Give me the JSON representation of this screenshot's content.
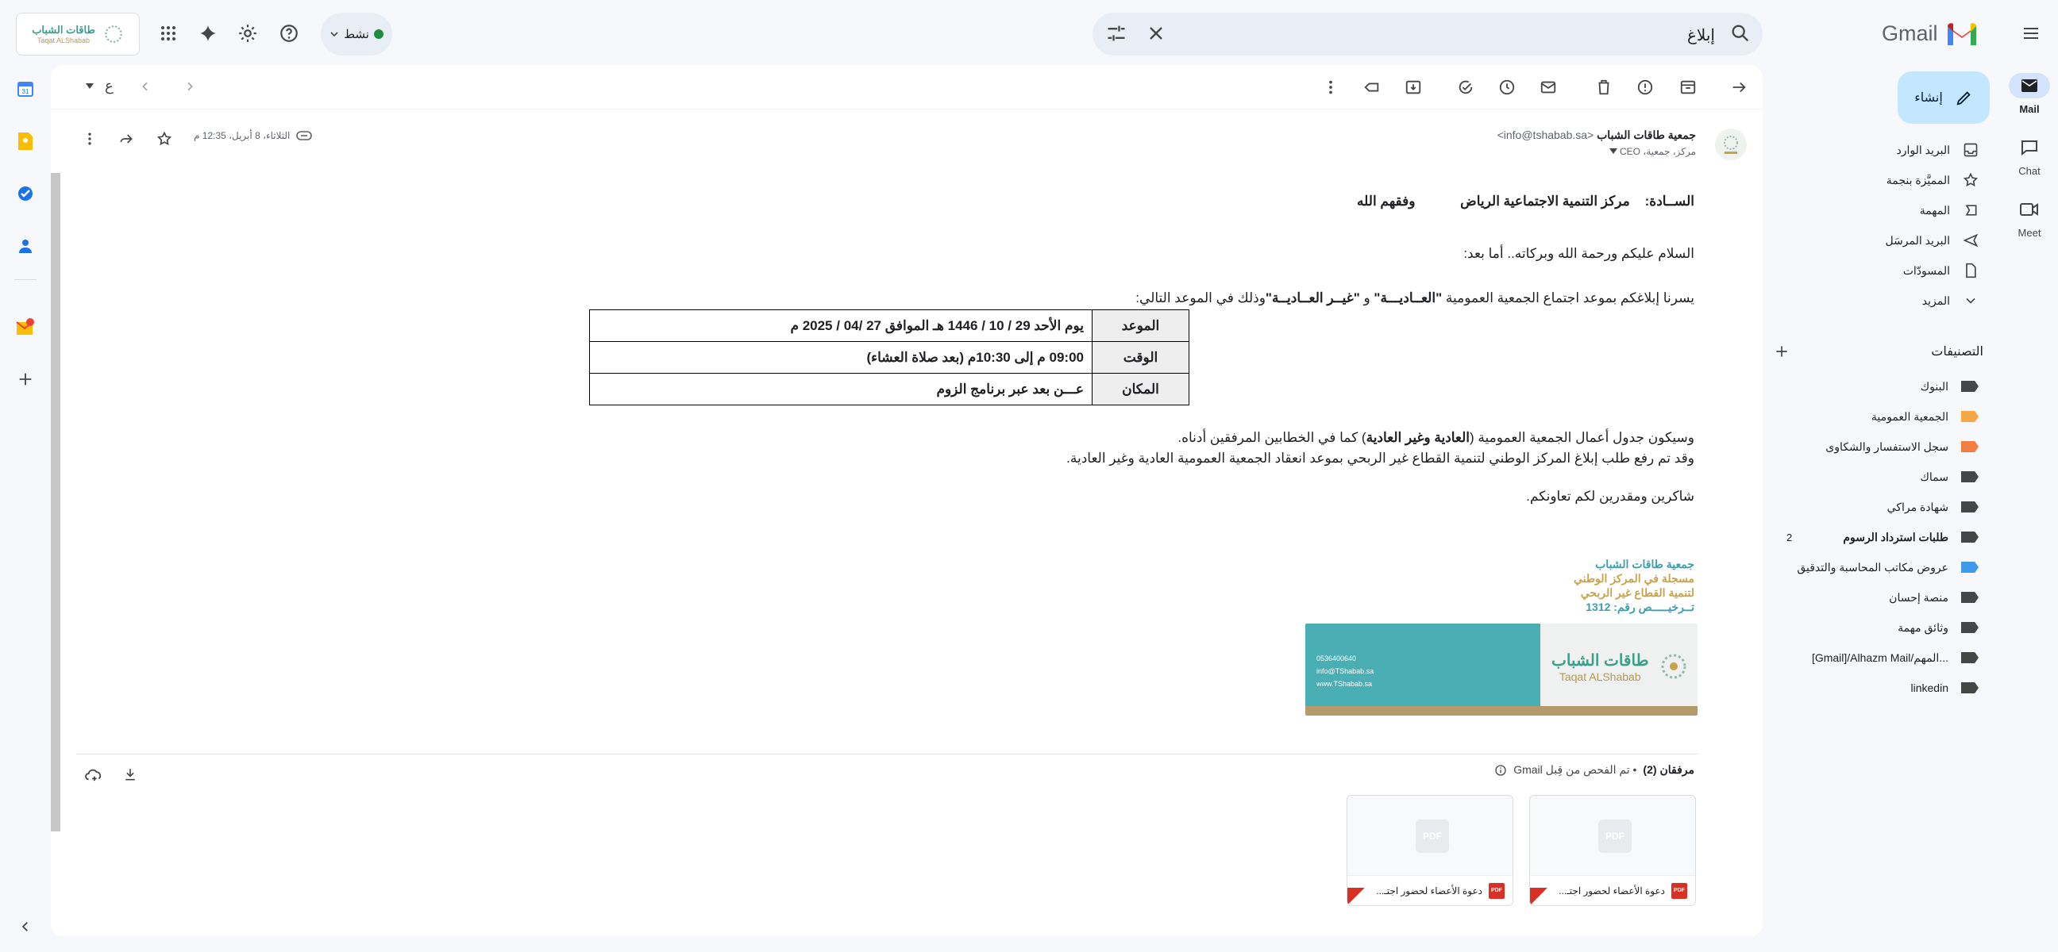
{
  "app": {
    "name": "Gmail",
    "menu_icon": "hamburger-menu-icon"
  },
  "search": {
    "query": "إبلاغ",
    "icon": "search-icon",
    "clear_icon": "close-icon",
    "options_icon": "tune-icon"
  },
  "status": {
    "label": "نشط",
    "color": "#1e8e3e"
  },
  "org_logo": {
    "name_ar": "طاقات الشباب",
    "name_en": "Taqat ALShabab"
  },
  "rail": [
    {
      "label": "Mail",
      "icon": "mail-icon",
      "active": true
    },
    {
      "label": "Chat",
      "icon": "chat-icon",
      "active": false
    },
    {
      "label": "Meet",
      "icon": "video-icon",
      "active": false
    }
  ],
  "compose": {
    "label": "إنشاء"
  },
  "nav": [
    {
      "label": "البريد الوارد",
      "icon": "inbox-icon"
    },
    {
      "label": "المميَّزة بنجمة",
      "icon": "star-icon"
    },
    {
      "label": "المهمة",
      "icon": "important-icon"
    },
    {
      "label": "البريد المرسَل",
      "icon": "send-icon"
    },
    {
      "label": "المسودّات",
      "icon": "draft-icon"
    },
    {
      "label": "المزيد",
      "icon": "chevron-down-icon"
    }
  ],
  "labels_header": {
    "title": "التصنيفات",
    "add_icon": "plus-icon"
  },
  "labels": [
    {
      "label": "البنوك",
      "color": "#444746",
      "count": ""
    },
    {
      "label": "الجمعية العمومية",
      "color": "#f6a844",
      "count": ""
    },
    {
      "label": "سجل الاستفسار والشكاوى",
      "color": "#f07d43",
      "count": ""
    },
    {
      "label": "سماك",
      "color": "#444746",
      "count": ""
    },
    {
      "label": "شهادة مراكي",
      "color": "#444746",
      "count": ""
    },
    {
      "label": "طلبات استرداد الرسوم",
      "color": "#444746",
      "count": "2",
      "bold": true
    },
    {
      "label": "عروض مكاتب المحاسبة والتدقيق",
      "color": "#3d9be9",
      "count": ""
    },
    {
      "label": "منصة إحسان",
      "color": "#444746",
      "count": ""
    },
    {
      "label": "وثائق مهمة",
      "color": "#444746",
      "count": ""
    },
    {
      "label": "[Gmail]/Alhazm Mail/المهم...",
      "color": "#444746",
      "count": ""
    },
    {
      "label": "linkedin",
      "color": "#444746",
      "count": ""
    }
  ],
  "toolbar": {
    "lang_indicator": "ع"
  },
  "message": {
    "sender_name": "جمعية طاقات الشباب",
    "sender_email": "<info@tshabab.sa>",
    "to_line": "مركز، جمعية، CEO",
    "date": "الثلاثاء، 8 أبريل، 12:35 م",
    "salutation_prefix": "الســادة:",
    "salutation_name": "مركز التنمية الاجتماعية الرياض",
    "salutation_suffix": "وفقهم الله",
    "greeting": "السلام عليكم ورحمة الله وبركاته.. أما بعد:",
    "announce_a": "يسرنا إبلاغكم بموعد  اجتماع الجمعية العمومية ",
    "announce_b": "\"العــاديـــة\"",
    "announce_c": " و ",
    "announce_d": "\"غيــر العــاديــة\"",
    "announce_e": "وذلك في الموعد التالي:",
    "table": [
      {
        "key": "الموعد",
        "value": "يوم الأحد 29 / 10 / 1446 هـ الموافق 27 /04 / 2025 م"
      },
      {
        "key": "الوقت",
        "value": "09:00 م إلى 10:30م (بعد صلاة العشاء)"
      },
      {
        "key": "المكان",
        "value": "عـــن بعد عبر برنامج الزوم"
      }
    ],
    "agenda_a": "وسيكون جدول أعمال الجمعية العمومية (",
    "agenda_b": "العادية وغير العادية",
    "agenda_c": ") كما في الخطابين المرفقين أدناه.",
    "request": "وقد تم رفع طلب إبلاغ المركز الوطني لتنمية القطاع غير الربحي بموعد انعقاد الجمعية العمومية العادية وغير العادية.",
    "thanks": "شاكرين ومقدرين لكم تعاونكم."
  },
  "signature": {
    "line1": "جمعية طاقات الشباب",
    "line2": "مسجلة في المركز الوطني",
    "line3": "لتنمية القطاع غير الربحي",
    "line4": "تــرخيـــــص رقم: 1312"
  },
  "banner": {
    "name_ar": "طاقات الشباب",
    "name_en": "Taqat ALShabab",
    "phone": "0536400640",
    "email": "info@TShabab.sa",
    "web": "www.TShabab.sa",
    "teal": "#4aafb4",
    "beige": "#b59a6a"
  },
  "attachments": {
    "title": "مرفقان (2)",
    "scan_note": "• تم الفحص من قِبل Gmail",
    "items": [
      {
        "name": "دعوة الأعضاء لحضور اجتـ..."
      },
      {
        "name": "دعوة الأعضاء لحضور اجتـ..."
      }
    ]
  }
}
